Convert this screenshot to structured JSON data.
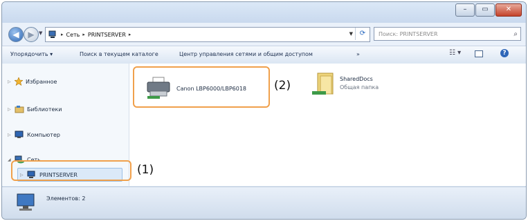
{
  "window": {
    "controls": {
      "minimize": "–",
      "maximize": "▭",
      "close": "✕"
    }
  },
  "address": {
    "path": [
      "Сеть",
      "PRINTSERVER"
    ],
    "search_placeholder": "Поиск: PRINTSERVER"
  },
  "toolbar": {
    "organize": "Упорядочить ▾",
    "search_catalog": "Поиск в текущем каталоге",
    "network_center": "Центр управления сетями и общим доступом",
    "more": "»"
  },
  "sidebar": {
    "favorites": "Избранное",
    "libraries": "Библиотеки",
    "computer": "Компьютер",
    "network": "Сеть",
    "printserver": "PRINTSERVER"
  },
  "content": {
    "printer_label": "Canon LBP6000/LBP6018",
    "folder_name": "SharedDocs",
    "folder_type": "Общая папка"
  },
  "status": {
    "items": "Элементов: 2"
  },
  "annotations": {
    "callout1": "(1)",
    "callout2": "(2)"
  },
  "colors": {
    "callout": "#f0a04b",
    "accent": "#2d67b4"
  }
}
